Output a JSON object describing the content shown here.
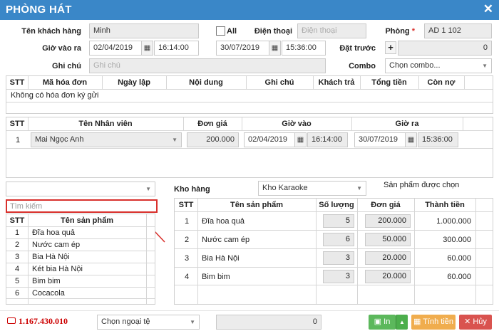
{
  "title": "PHÒNG HÁT",
  "form": {
    "customer_label": "Tên khách hàng",
    "customer_value": "Minh",
    "all_label": "All",
    "phone_label": "Điện thoại",
    "phone_placeholder": "Điện thoại",
    "room_label": "Phòng",
    "room_required": "*",
    "room_value": "AD 1 102",
    "checkin_label": "Giờ vào ra",
    "checkin_date": "02/04/2019",
    "checkin_time": "16:14:00",
    "checkout_date": "30/07/2019",
    "checkout_time": "15:36:00",
    "deposit_label": "Đặt trước",
    "deposit_value": "0",
    "note_label": "Ghi chú",
    "note_placeholder": "Ghi chú",
    "combo_label": "Combo",
    "combo_value": "Chọn combo..."
  },
  "invoice_table": {
    "headers": [
      "STT",
      "Mã hóa đơn",
      "Ngày lập",
      "Nội dung",
      "Ghi chú",
      "Khách trả",
      "Tổng tiền",
      "Còn nợ"
    ],
    "empty_text": "Không có hóa đơn ký gửi"
  },
  "staff_table": {
    "headers": [
      "STT",
      "Tên Nhân viên",
      "Đơn giá",
      "Giờ vào",
      "Giờ ra"
    ],
    "rows": [
      {
        "stt": "1",
        "name": "Mai Ngọc Anh",
        "price": "200.000",
        "in_date": "02/04/2019",
        "in_time": "16:14:00",
        "out_date": "30/07/2019",
        "out_time": "15:36:00"
      }
    ]
  },
  "product_search": {
    "placeholder": "Tìm kiếm",
    "headers": [
      "STT",
      "Tên sản phẩm"
    ],
    "items": [
      {
        "stt": "1",
        "name": "Đĩa hoa quả"
      },
      {
        "stt": "2",
        "name": "Nước cam ép"
      },
      {
        "stt": "3",
        "name": "Bia Hà Nội"
      },
      {
        "stt": "4",
        "name": "Két bia Hà Nội"
      },
      {
        "stt": "5",
        "name": "Bim bim"
      },
      {
        "stt": "6",
        "name": "Cocacola"
      }
    ]
  },
  "warehouse": {
    "label": "Kho hàng",
    "value": "Kho Karaoke",
    "selected_label": "Sản phẩm được chọn"
  },
  "selected_table": {
    "headers": [
      "STT",
      "Tên sản phẩm",
      "Số lượng",
      "Đơn giá",
      "Thành tiền"
    ],
    "rows": [
      {
        "stt": "1",
        "name": "Đĩa hoa quả",
        "qty": "5",
        "price": "200.000",
        "total": "1.000.000"
      },
      {
        "stt": "2",
        "name": "Nước cam ép",
        "qty": "6",
        "price": "50.000",
        "total": "300.000"
      },
      {
        "stt": "3",
        "name": "Bia Hà Nội",
        "qty": "3",
        "price": "20.000",
        "total": "60.000"
      },
      {
        "stt": "4",
        "name": "Bim bim",
        "qty": "3",
        "price": "20.000",
        "total": "60.000"
      }
    ]
  },
  "footer": {
    "total": "1.167.430.010",
    "currency_placeholder": "Chọn ngoại tệ",
    "amount": "0",
    "print_label": "In",
    "calc_label": "Tính tiền",
    "cancel_label": "Hủy"
  },
  "colors": {
    "titlebar": "#3a87c8",
    "print_btn": "#5cb85c",
    "calc_btn": "#f0ad4e",
    "cancel_btn": "#d9534f",
    "total_red": "#cc0000",
    "highlight_red": "#d9302c"
  }
}
